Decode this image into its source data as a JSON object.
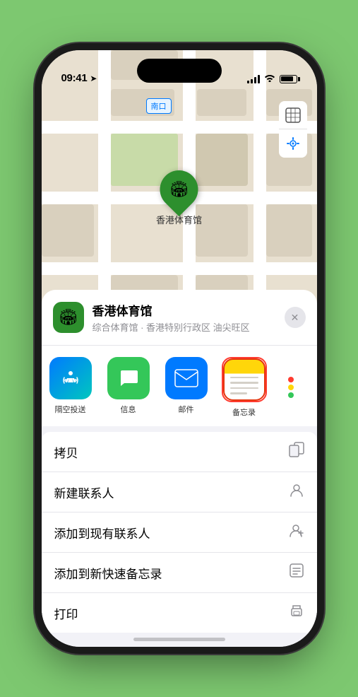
{
  "status_bar": {
    "time": "09:41",
    "time_icon": "location-arrow"
  },
  "map": {
    "label": "南口",
    "marker_label": "香港体育馆"
  },
  "location_card": {
    "name": "香港体育馆",
    "detail": "综合体育馆 · 香港特别行政区 油尖旺区",
    "close_icon": "✕"
  },
  "share_apps": [
    {
      "id": "airdrop",
      "label": "隔空投送"
    },
    {
      "id": "messages",
      "label": "信息"
    },
    {
      "id": "mail",
      "label": "邮件"
    },
    {
      "id": "notes",
      "label": "备忘录"
    },
    {
      "id": "more",
      "label": ""
    }
  ],
  "action_rows": [
    {
      "label": "拷贝",
      "icon": "copy"
    },
    {
      "label": "新建联系人",
      "icon": "person"
    },
    {
      "label": "添加到现有联系人",
      "icon": "person-add"
    },
    {
      "label": "添加到新快速备忘录",
      "icon": "note"
    },
    {
      "label": "打印",
      "icon": "print"
    }
  ],
  "more_dots_colors": [
    "#ff3b30",
    "#ffd60a",
    "#34c759"
  ]
}
